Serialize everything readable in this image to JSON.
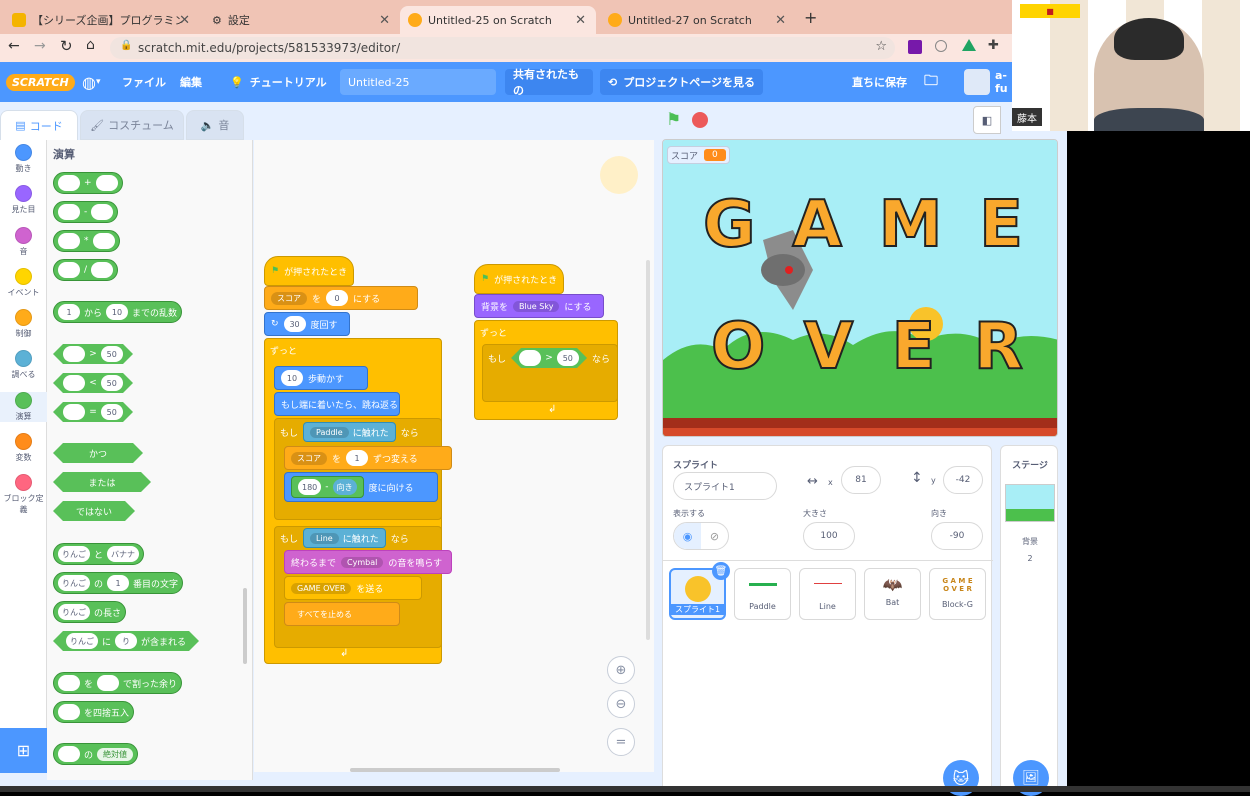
{
  "browser": {
    "tabs": [
      {
        "title": "【シリーズ企画】プログラミング_キャッチ"
      },
      {
        "title": "設定"
      },
      {
        "title": "Untitled-25 on Scratch"
      },
      {
        "title": "Untitled-27 on Scratch"
      }
    ],
    "url": "scratch.mit.edu/projects/581533973/editor/"
  },
  "menubar": {
    "logo": "SCRATCH",
    "file": "ファイル",
    "edit": "編集",
    "tutorial": "チュートリアル",
    "project_title": "Untitled-25",
    "shared": "共有されたもの",
    "see_project": "プロジェクトページを見る",
    "save_now": "直ちに保存",
    "user": "a-fu"
  },
  "editor_tabs": {
    "code": "コード",
    "costume": "コスチューム",
    "sound": "音"
  },
  "categories": [
    {
      "label": "動き",
      "color": "#4c97ff"
    },
    {
      "label": "見た目",
      "color": "#9966ff"
    },
    {
      "label": "音",
      "color": "#cf63cf"
    },
    {
      "label": "イベント",
      "color": "#ffd500"
    },
    {
      "label": "制御",
      "color": "#ffab19"
    },
    {
      "label": "調べる",
      "color": "#5cb1d6"
    },
    {
      "label": "演算",
      "color": "#59c059"
    },
    {
      "label": "変数",
      "color": "#ff8c1a"
    },
    {
      "label": "ブロック定義",
      "color": "#ff6680"
    }
  ],
  "palette": {
    "heading": "演算",
    "ops": [
      "+",
      "-",
      "*",
      "/"
    ],
    "random_from": "1",
    "random_kara": "から",
    "random_to": "10",
    "random_label": "までの乱数",
    "gt": ">",
    "lt": "<",
    "eq": "=",
    "cmp_val": "50",
    "and": "かつ",
    "or": "または",
    "not": "ではない",
    "apple": "りんご",
    "to": "と",
    "banana": "バナナ",
    "no": "の",
    "one": "1",
    "nth_char": "番目の文字",
    "length": "の長さ",
    "ni": "に",
    "ri": "り",
    "contains": "が含まれる",
    "wo": "を",
    "mod": "で割った余り",
    "round": "を四捨五入",
    "abs_no": "の",
    "abs": "絶対値"
  },
  "script1": {
    "hat": "が押されたとき",
    "set_var": "スコア",
    "set_wo": "を",
    "set_val": "0",
    "set_label": "にする",
    "repeat_val": "30",
    "repeat_label": "度回す",
    "forever": "ずっと",
    "move_val": "10",
    "move_label": "歩動かす",
    "bounce": "もし端に着いたら、跳ね返る",
    "if1": "もし",
    "touch_paddle": "Paddle",
    "touched": "に触れた",
    "then": "なら",
    "change_var": "スコア",
    "change_wo": "を",
    "change_val": "1",
    "change_label": "ずつ変える",
    "turn_val": "180",
    "minus": "-",
    "direction": "向き",
    "turn_label": "度に向ける",
    "if2": "もし",
    "touch_line": "Line",
    "touched2": "に触れた",
    "then2": "なら",
    "play_until": "終わるまで",
    "sound": "Cymbal",
    "play_label": "の音を鳴らす",
    "broadcast": "GAME OVER",
    "broadcast_label": "を送る",
    "stop": "すべてを止める"
  },
  "script2": {
    "hat": "が押されたとき",
    "backdrop_label": "背景を",
    "backdrop": "Blue Sky",
    "backdrop_set": "にする",
    "forever": "ずっと",
    "if": "もし",
    "gt": ">",
    "val": "50",
    "then": "なら"
  },
  "stage": {
    "score_label": "スコア",
    "score_value": "0",
    "game_line1": [
      "G",
      "A",
      "M",
      "E"
    ],
    "game_line2": [
      "O",
      "V",
      "E",
      "R"
    ]
  },
  "sprite_info": {
    "sprite_label": "スプライト",
    "sprite_name": "スプライト1",
    "x_label": "x",
    "x": "81",
    "y_label": "y",
    "y": "-42",
    "show_label": "表示する",
    "size_label": "大きさ",
    "size": "100",
    "dir_label": "向き",
    "direction": "-90"
  },
  "sprites": [
    {
      "name": "スプライト1"
    },
    {
      "name": "Paddle"
    },
    {
      "name": "Line"
    },
    {
      "name": "Bat"
    },
    {
      "name": "Block-G"
    }
  ],
  "stage_panel": {
    "title": "ステージ",
    "backdrop_label": "背景",
    "count": "2"
  },
  "webcam": {
    "name_tag": "藤本"
  }
}
